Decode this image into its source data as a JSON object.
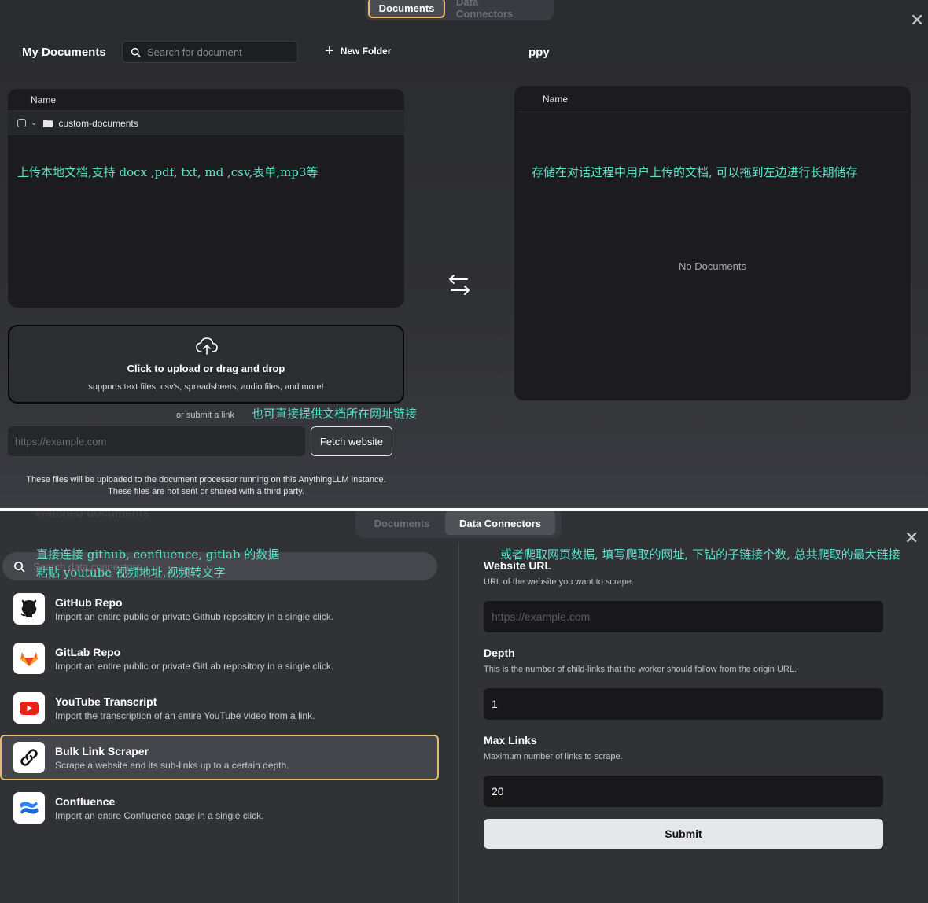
{
  "top": {
    "tabs": [
      "Documents",
      "Data Connectors"
    ],
    "active_tab": "Documents",
    "my_documents_title": "My Documents",
    "search_placeholder": "Search for document",
    "new_folder_label": "New Folder",
    "workspace_title": "ppy",
    "left_table": {
      "column_header": "Name",
      "folder_name": "custom-documents",
      "annotation": "上传本地文档,支持 docx ,pdf, txt, md ,csv,表单,mp3等"
    },
    "right_table": {
      "column_header": "Name",
      "annotation": "存储在对话过程中用户上传的文档, 可以拖到左边进行长期储存",
      "empty_text": "No Documents"
    },
    "upload": {
      "title": "Click to upload or drag and drop",
      "subtitle": "supports text files, csv's, spreadsheets, audio files, and more!"
    },
    "or_submit_link": "or submit a link",
    "link_annotation": "也可直接提供文档所在网址链接",
    "link_placeholder": "https://example.com",
    "fetch_label": "Fetch website",
    "disclaimer_line1": "These files will be uploaded to the document processor running on this AnythingLLM instance.",
    "disclaimer_line2": "These files are not sent or shared with a third party."
  },
  "bottom": {
    "ghost_heading": "Watched documents",
    "tabs": [
      "Documents",
      "Data Connectors"
    ],
    "active_tab": "Data Connectors",
    "search_placeholder": "Search data connectors",
    "annotation_left_1": "直接连接 github, confluence, gitlab 的数据",
    "annotation_left_2": "粘贴 youtube 视频地址,视频转文字",
    "annotation_right": "或者爬取网页数据, 填写爬取的网址, 下钻的子链接个数, 总共爬取的最大链接",
    "connectors": [
      {
        "title": "GitHub Repo",
        "desc": "Import an entire public or private Github repository in a single click.",
        "icon": "github-icon"
      },
      {
        "title": "GitLab Repo",
        "desc": "Import an entire public or private GitLab repository in a single click.",
        "icon": "gitlab-icon"
      },
      {
        "title": "YouTube Transcript",
        "desc": "Import the transcription of an entire YouTube video from a link.",
        "icon": "youtube-icon"
      },
      {
        "title": "Bulk Link Scraper",
        "desc": "Scrape a website and its sub-links up to a certain depth.",
        "icon": "link-icon",
        "selected": true
      },
      {
        "title": "Confluence",
        "desc": "Import an entire Confluence page in a single click.",
        "icon": "confluence-icon"
      }
    ],
    "form": {
      "url_label": "Website URL",
      "url_help": "URL of the website you want to scrape.",
      "url_placeholder": "https://example.com",
      "depth_label": "Depth",
      "depth_help": "This is the number of child-links that the worker should follow from the origin URL.",
      "depth_value": "1",
      "max_label": "Max Links",
      "max_help": "Maximum number of links to scrape.",
      "max_value": "20",
      "submit_label": "Submit"
    }
  },
  "colors": {
    "accent": "#e8b870",
    "annotation": "#5ee0c8",
    "panel_bg": "#1c1c1e"
  }
}
